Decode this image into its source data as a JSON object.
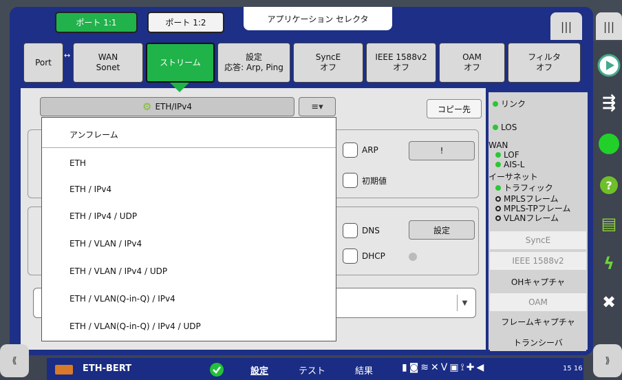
{
  "ports": [
    "ポート 1:1",
    "ポート 1:2"
  ],
  "app_selector": "アプリケーション セレクタ",
  "top_right_icons": [
    "|||",
    "|||"
  ],
  "nav_tabs": [
    {
      "line1": "Port",
      "line2": ""
    },
    {
      "line1": "WAN",
      "line2": "Sonet"
    },
    {
      "line1": "ストリーム",
      "line2": ""
    },
    {
      "line1": "設定",
      "line2": "応答: Arp, Ping"
    },
    {
      "line1": "SyncE",
      "line2": "オフ"
    },
    {
      "line1": "IEEE 1588v2",
      "line2": "オフ"
    },
    {
      "line1": "OAM",
      "line2": "オフ"
    },
    {
      "line1": "フィルタ",
      "line2": "オフ"
    }
  ],
  "stream_header": "ETH/IPv4",
  "list_button": "≡▾",
  "copy_button": "コピー先",
  "checks": {
    "arp": "ARP",
    "initial": "初期値",
    "dns": "DNS",
    "dhcp": "DHCP"
  },
  "buttons": {
    "arp_btn": "!",
    "dns_btn": "設定"
  },
  "dropdown_items": [
    "アンフレーム",
    "ETH",
    "ETH / IPv4",
    "ETH / IPv4 / UDP",
    "ETH / VLAN / IPv4",
    "ETH / VLAN / IPv4 / UDP",
    "ETH / VLAN(Q-in-Q) / IPv4",
    "ETH / VLAN(Q-in-Q) / IPv4 / UDP"
  ],
  "status": {
    "link": "リンク",
    "los": "LOS",
    "wan": "WAN",
    "lof": "LOF",
    "ais": "AIS-L",
    "ethernet": "イーサネット",
    "traffic": "トラフィック",
    "mpls": "MPLSフレーム",
    "mpls_tp": "MPLS-TPフレーム",
    "vlan": "VLANフレーム",
    "buttons": [
      "SyncE",
      "IEEE 1588v2",
      "OHキャプチャ",
      "OAM",
      "フレームキャプチャ",
      "トランシーバ"
    ]
  },
  "bottom": {
    "app": "ETH-BERT",
    "setup": "設定",
    "test": "テスト",
    "results": "結果",
    "time": "15 16"
  },
  "colors": {
    "accent_green": "#1fb349",
    "frame_blue": "#1d2f86"
  }
}
